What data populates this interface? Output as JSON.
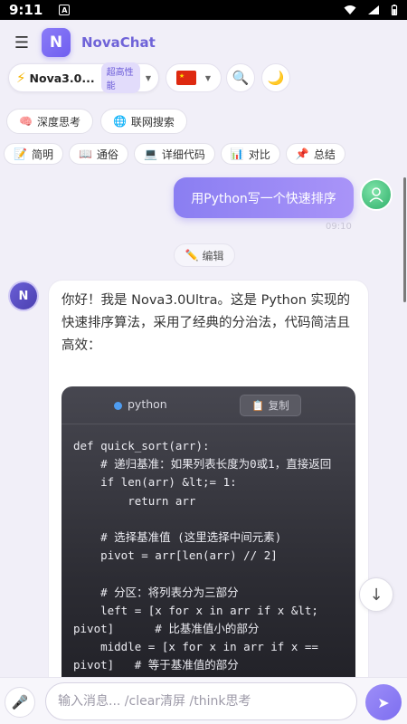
{
  "status_bar": {
    "time": "9:11",
    "badge": "A"
  },
  "header": {
    "app_name": "NovaChat",
    "logo_letter": "N",
    "menu_icon": "hamburger-icon"
  },
  "toolbar": {
    "model_name": "Nova3.0...",
    "model_badge": "超高性能",
    "language_flag": "cn-flag-icon",
    "search_icon": "search-icon",
    "theme_icon": "moon-icon"
  },
  "chips": {
    "primary": [
      {
        "label": "深度思考",
        "icon": "brain-icon"
      },
      {
        "label": "联网搜索",
        "icon": "globe-icon"
      }
    ],
    "secondary": [
      {
        "label": "简明",
        "icon": "memo-icon"
      },
      {
        "label": "通俗",
        "icon": "book-icon"
      },
      {
        "label": "详细代码",
        "icon": "laptop-icon"
      },
      {
        "label": "对比",
        "icon": "chart-icon"
      },
      {
        "label": "总结",
        "icon": "pin-icon"
      }
    ]
  },
  "user_message": {
    "text": "用Python写一个快速排序",
    "time": "09:10"
  },
  "edit_label": "编辑",
  "bot_message": {
    "avatar_letter": "N",
    "text": "你好！我是 Nova3.0Ultra。这是 Python 实现的快速排序算法，采用了经典的分治法，代码简洁且高效：",
    "code_language": "python",
    "copy_label": "复制",
    "code_lines": [
      "def quick_sort(arr):",
      "    # 递归基准：如果列表长度为0或1，直接返回",
      "    if len(arr) &lt;= 1:",
      "        return arr",
      "",
      "    # 选择基准值 (这里选择中间元素)",
      "    pivot = arr[len(arr) // 2]",
      "",
      "    # 分区：将列表分为三部分",
      "    left = [x for x in arr if x &lt;",
      "pivot]      # 比基准值小的部分",
      "    middle = [x for x in arr if x ==",
      "pivot]   # 等于基准值的部分"
    ]
  },
  "input": {
    "placeholder": "输入消息... /clear清屏 /think思考",
    "value": ""
  },
  "colors": {
    "accent": "#7d6ef0",
    "user_bubble": "#9485f5",
    "code_bg": "#2c2c33"
  }
}
